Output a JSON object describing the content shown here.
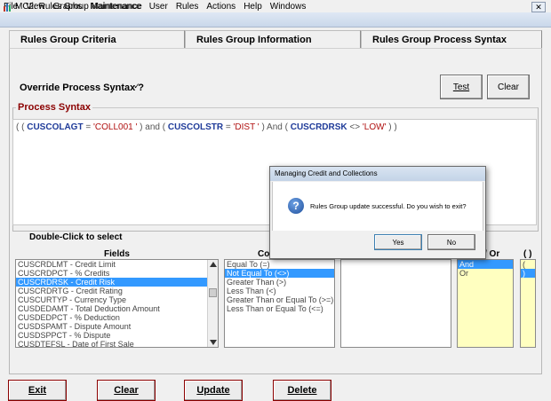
{
  "menu": [
    "File",
    "View",
    "Graphs",
    "Maintenance",
    "User",
    "Rules",
    "Actions",
    "Help",
    "Windows"
  ],
  "window": {
    "title": "MC2: Rules Group Maintenance",
    "close": "✕"
  },
  "tabs": {
    "criteria": "Rules Group Criteria",
    "info": "Rules Group Information",
    "syntax": "Rules Group Process Syntax"
  },
  "override": {
    "label": "Override Process Syntax ?",
    "checked": "✓"
  },
  "buttons": {
    "test": "Test",
    "clear_top": "Clear",
    "exit": "Exit",
    "clear": "Clear",
    "update": "Update",
    "delete": "Delete"
  },
  "process_syntax": {
    "legend": "Process Syntax",
    "open": "( (",
    "field1": "CUSCOLAGT",
    "op1": "=",
    "val1": "'COLL001 '",
    "mid1": ") and (",
    "field2": "CUSCOLSTR",
    "op2": "=",
    "val2": "'DIST '",
    "mid2": ") And (",
    "field3": "CUSCRDRSK",
    "op3": "<>",
    "val3": "'LOW'",
    "close": ") )"
  },
  "double_click_label": "Double-Click to select",
  "columns": {
    "fields": "Fields",
    "conditions": "Co",
    "andor": "/ Or",
    "paren": "( )"
  },
  "fields_list": [
    "CUSCRDLMT - Credit Limit",
    "CUSCRDPCT - % Credits",
    "CUSCRDRSK - Credit Risk",
    "CUSCRDRTG - Credit Rating",
    "CUSCURTYP - Currency Type",
    "CUSDEDAMT - Total Deduction Amount",
    "CUSDEDPCT - % Deduction",
    "CUSDSPAMT - Dispute Amount",
    "CUSDSPPCT - % Dispute",
    "CUSDTEFSL - Date of First Sale"
  ],
  "conditions_list": [
    "Equal To (=)",
    "Not Equal To (<>)",
    "Greater Than (>)",
    "Less Than (<)",
    "Greater Than or Equal To (>=)",
    "Less Than or Equal To (<=)"
  ],
  "andor_list": [
    "And",
    "Or"
  ],
  "paren_list": [
    "(",
    ")"
  ],
  "dialog": {
    "title": "Managing Credit and Collections",
    "message": "Rules Group update successful. Do you wish to exit?",
    "icon": "?",
    "yes": "Yes",
    "no": "No"
  }
}
